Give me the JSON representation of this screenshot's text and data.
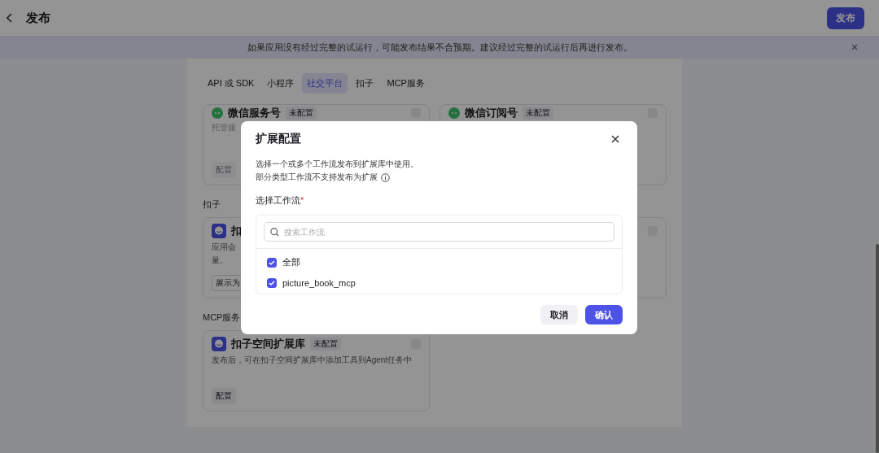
{
  "header": {
    "title": "发布",
    "publish_button": "发布"
  },
  "banner": {
    "text": "如果应用没有经过完整的试运行，可能发布结果不合预期。建议经过完整的试运行后再进行发布。"
  },
  "tabs": [
    {
      "label": "API 或 SDK",
      "selected": false
    },
    {
      "label": "小程序",
      "selected": false
    },
    {
      "label": "社交平台",
      "selected": true
    },
    {
      "label": "扣子",
      "selected": false
    },
    {
      "label": "MCP服务",
      "selected": false
    }
  ],
  "sections": [
    {
      "cards": [
        {
          "kind": "chat",
          "title": "微信服务号",
          "status": "未配置",
          "lines": [
            "托管服"
          ],
          "button": "配置",
          "checked": false
        },
        {
          "kind": "chat",
          "title": "微信订阅号",
          "status": "未配置",
          "checked": false
        }
      ]
    },
    {
      "heading": "扣子",
      "cards": [
        {
          "kind": "app",
          "title": "扣",
          "lines": [
            "应用会",
            "量。"
          ],
          "select": "展示为"
        },
        {
          "checked": false
        }
      ]
    },
    {
      "heading": "MCP服务",
      "cards": [
        {
          "kind": "app",
          "title": "扣子空间扩展库",
          "status": "未配置",
          "lines": [
            "发布后，可在扣子空间扩展库中添加工具到Agent任务中"
          ],
          "button": "配置",
          "checked": false
        }
      ]
    }
  ],
  "dialog": {
    "title": "扩展配置",
    "lines": [
      "选择一个或多个工作流发布到扩展库中使用。",
      "部分类型工作流不支持发布为扩展"
    ],
    "field_label": "选择工作流",
    "required_mark": "*",
    "search_placeholder": "搜索工作流",
    "options": [
      {
        "label": "全部",
        "checked": true
      },
      {
        "label": "picture_book_mcp",
        "checked": true
      }
    ],
    "cancel": "取消",
    "confirm": "确认"
  }
}
